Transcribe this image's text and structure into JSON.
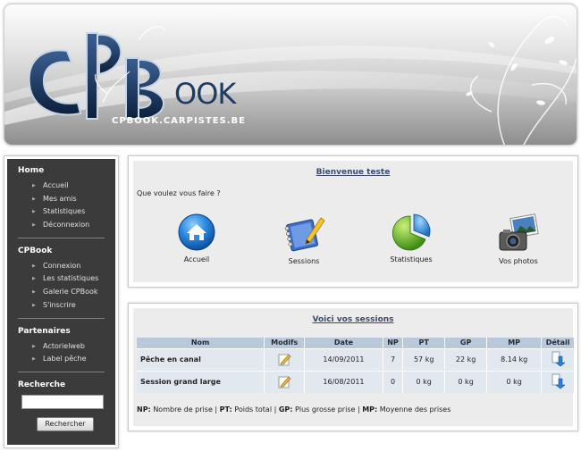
{
  "header": {
    "site_url": "CPBOOK.CARPISTES.BE",
    "logo_suffix": "OOK"
  },
  "sidebar": {
    "sections": [
      {
        "title": "Home",
        "items": [
          "Accueil",
          "Mes amis",
          "Statistiques",
          "Déconnexion"
        ]
      },
      {
        "title": "CPBook",
        "items": [
          "Connexion",
          "Les statistiques",
          "Galerie CPBook",
          "S'inscrire"
        ]
      },
      {
        "title": "Partenaires",
        "items": [
          "Actorielweb",
          "Label pêche"
        ]
      }
    ],
    "search": {
      "title": "Recherche",
      "input_value": "",
      "button_label": "Rechercher"
    }
  },
  "welcome": {
    "title": "Bienvenue teste",
    "question": "Que voulez vous faire ?",
    "actions": [
      {
        "label": "Accueil",
        "icon": "home-icon"
      },
      {
        "label": "Sessions",
        "icon": "sessions-notebook-icon"
      },
      {
        "label": "Statistiques",
        "icon": "statistics-pie-icon"
      },
      {
        "label": "Vos photos",
        "icon": "camera-photos-icon"
      }
    ]
  },
  "sessions": {
    "title": "Voici vos sessions",
    "columns": [
      "Nom",
      "Modifs",
      "Date",
      "NP",
      "PT",
      "GP",
      "MP",
      "Détail"
    ],
    "rows": [
      {
        "name": "Pêche en canal",
        "date": "14/09/2011",
        "np": "7",
        "pt": "57 kg",
        "gp": "22 kg",
        "mp": "8.14 kg"
      },
      {
        "name": "Session grand large",
        "date": "16/08/2011",
        "np": "0",
        "pt": "0 kg",
        "gp": "0 kg",
        "mp": "0 kg"
      }
    ],
    "legend": {
      "np_abbr": "NP:",
      "np_text": "Nombre de prise",
      "pt_abbr": "PT:",
      "pt_text": "Poids total",
      "gp_abbr": "GP:",
      "gp_text": "Plus grosse prise",
      "mp_abbr": "MP:",
      "mp_text": "Moyenne des prises"
    }
  },
  "colors": {
    "sidebar_bg": "#3b3b3b",
    "panel_bg": "#ececec",
    "table_header": "#b8c9dc",
    "table_row": "#e2e8f0",
    "title_link": "#3b4a72",
    "logo_blue": "#1d3c64"
  }
}
